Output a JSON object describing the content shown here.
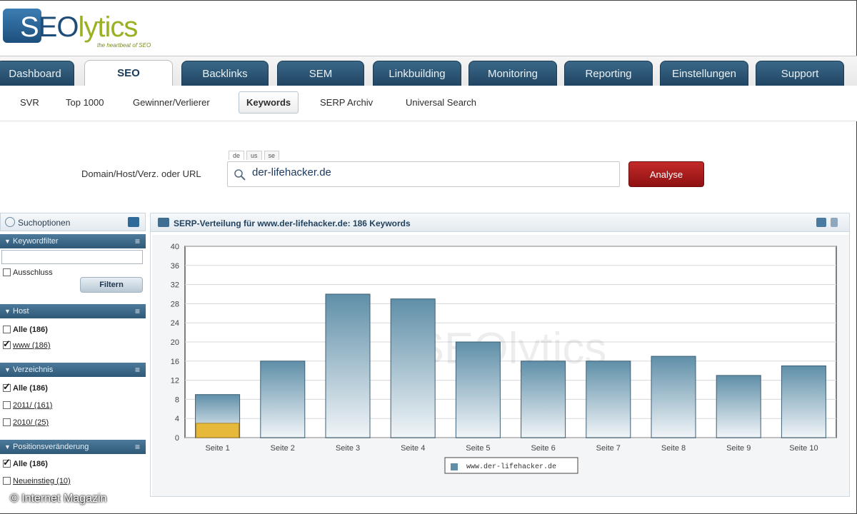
{
  "logo": {
    "s": "S",
    "eo": "EO",
    "lytics": "lytics",
    "tagline": "the heartbeat of SEO"
  },
  "main_nav": [
    "Dashboard",
    "SEO",
    "Backlinks",
    "SEM",
    "Linkbuilding",
    "Monitoring",
    "Reporting",
    "Einstellungen",
    "Support"
  ],
  "main_nav_active": "SEO",
  "sub_nav": [
    "SVR",
    "Top 1000",
    "Gewinner/Verlierer",
    "Keywords",
    "SERP Archiv",
    "Universal Search"
  ],
  "sub_nav_active": "Keywords",
  "search": {
    "label": "Domain/Host/Verz. oder URL",
    "lang_tabs": [
      "de",
      "us",
      "se"
    ],
    "value": "der-lifehacker.de",
    "button": "Analyse"
  },
  "sidebar": {
    "title": "Suchoptionen",
    "keywordfilter": {
      "title": "Keywordfilter",
      "exclude_label": "Ausschluss",
      "filter_button": "Filtern"
    },
    "host": {
      "title": "Host",
      "items": [
        {
          "label": "Alle (186)",
          "checked": false,
          "bold": true
        },
        {
          "label": "www (186)",
          "checked": true,
          "underline": true
        }
      ]
    },
    "verzeichnis": {
      "title": "Verzeichnis",
      "items": [
        {
          "label": "Alle (186)",
          "checked": true,
          "bold": true
        },
        {
          "label": "2011/ (161)",
          "checked": false,
          "underline": true
        },
        {
          "label": "2010/ (25)",
          "checked": false,
          "underline": true
        }
      ]
    },
    "positionsveraenderung": {
      "title": "Positionsveränderung",
      "items": [
        {
          "label": "Alle (186)",
          "checked": true,
          "bold": true
        },
        {
          "label": "Neueinstieg (10)",
          "checked": false,
          "underline": true
        }
      ]
    }
  },
  "chart_panel": {
    "title": "SERP-Verteilung für www.der-lifehacker.de: 186 Keywords",
    "watermark": "SEOlytics"
  },
  "chart_data": {
    "type": "bar",
    "title": "SERP-Verteilung für www.der-lifehacker.de: 186 Keywords",
    "categories": [
      "Seite 1",
      "Seite 2",
      "Seite 3",
      "Seite 4",
      "Seite 5",
      "Seite 6",
      "Seite 7",
      "Seite 8",
      "Seite 9",
      "Seite 10"
    ],
    "series": [
      {
        "name": "www.der-lifehacker.de",
        "values": [
          9,
          16,
          30,
          29,
          20,
          16,
          16,
          17,
          13,
          15
        ]
      }
    ],
    "highlight": {
      "category": "Seite 1",
      "value": 3,
      "color": "#e7b93b"
    },
    "ylim": [
      0,
      40
    ],
    "yticks": [
      0,
      4,
      8,
      12,
      16,
      20,
      24,
      28,
      32,
      36,
      40
    ],
    "grid": true,
    "legend": "bottom-center",
    "bar_color_top": "#5f8fa8",
    "bar_color_bottom": "#f1f5f8"
  },
  "copyright": "© Internet Magazin"
}
